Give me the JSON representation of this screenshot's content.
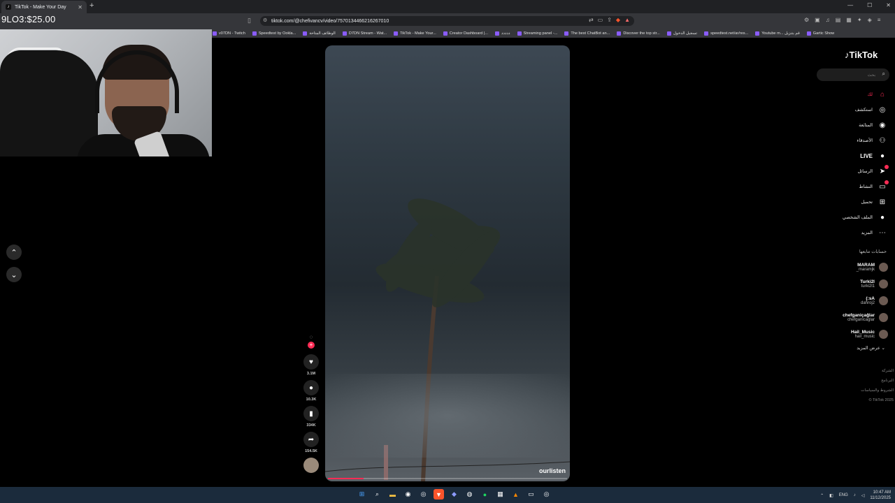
{
  "browser": {
    "tab_title": "TikTok - Make Your Day",
    "tab_favicon": "♪",
    "new_tab": "+",
    "url": "tiktok.com/@chefivancv/video/7570134466216267010",
    "bookmarks": [
      "v07DN - Twitch",
      "Speedtest by Ookla...",
      "الوظائف المتاحة",
      "D7DN Stream - Wat...",
      "TikTok - Make Your...",
      "Creator Dashboard |...",
      "ددددد",
      "Streaming panel -...",
      "The best ChatBot an...",
      "Discover the top str...",
      "تسجيل الدخول",
      "speedtest.net/ar/res...",
      "Youtube m... قم بتنزيل",
      "Gartic Show"
    ]
  },
  "overlay": {
    "score": "9LO3:$25.00"
  },
  "video": {
    "author": "ourlisten",
    "progress": 0.15
  },
  "actions": {
    "likes": "3.1M",
    "comments": "10.3K",
    "saves": "334K",
    "shares": "154.5K"
  },
  "tiktok": {
    "logo": "TikTok",
    "search_placeholder": "بحث",
    "menu": [
      {
        "label": "لك",
        "icon": "home-icon",
        "glyph": "⌂"
      },
      {
        "label": "استكشف",
        "icon": "compass-icon",
        "glyph": "◎"
      },
      {
        "label": "المتابَعة",
        "icon": "following-icon",
        "glyph": "◉"
      },
      {
        "label": "الأصدقاء",
        "icon": "friends-icon",
        "glyph": "⚇"
      },
      {
        "label": "LIVE",
        "icon": "live-icon",
        "glyph": "●"
      },
      {
        "label": "الرسائل",
        "icon": "messages-icon",
        "glyph": "➤"
      },
      {
        "label": "النشاط",
        "icon": "activity-icon",
        "glyph": "▭"
      },
      {
        "label": "تحميل",
        "icon": "upload-icon",
        "glyph": "⊞"
      },
      {
        "label": "الملف الشخصي",
        "icon": "profile-icon",
        "glyph": "●"
      },
      {
        "label": "المزيد",
        "icon": "more-icon",
        "glyph": "⋯"
      }
    ],
    "following_title": "حسابات تتابعها",
    "following": [
      {
        "name": "MARAM",
        "handle": "_maramjk"
      },
      {
        "name": "Turki2l",
        "handle": "turki2l1"
      },
      {
        "name": "(:sA",
        "handle": "dahroj2"
      },
      {
        "name": "chefganiçağlar",
        "handle": "chefganicaglar"
      },
      {
        "name": "Hail_Music",
        "handle": "hail_music"
      }
    ],
    "see_more": "عرض المزيد",
    "footer": [
      "الشركة",
      "البرنامج",
      "الشروط والسياسات",
      "© TikTok 2025"
    ]
  },
  "taskbar": {
    "time": "10:47 AM",
    "date": "11/12/2025",
    "lang": "ENG"
  }
}
